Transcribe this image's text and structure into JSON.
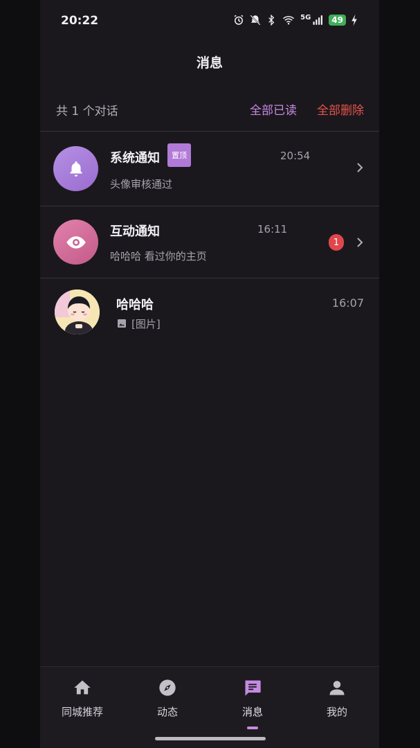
{
  "status_bar": {
    "time": "20:22",
    "network": "5G",
    "battery": "49",
    "icons": [
      "alarm-icon",
      "mute-icon",
      "bluetooth-icon",
      "wifi-icon",
      "signal-icon",
      "charging-icon"
    ]
  },
  "header": {
    "title": "消息"
  },
  "summary": {
    "count_text": "共 1 个对话",
    "mark_all_read": "全部已读",
    "delete_all": "全部删除"
  },
  "conversations": [
    {
      "name": "系统通知",
      "badge": "置顶",
      "time": "20:54",
      "preview": "头像审核通过",
      "icon": "bell-icon"
    },
    {
      "name": "互动通知",
      "time": "16:11",
      "preview": "哈哈哈 看过你的主页",
      "unread": "1",
      "icon": "eye-icon"
    },
    {
      "name": "哈哈哈",
      "time": "16:07",
      "preview": "[图片]",
      "icon": "image-icon"
    }
  ],
  "bottom_nav": {
    "items": [
      {
        "label": "同城推荐",
        "icon": "home-icon"
      },
      {
        "label": "动态",
        "icon": "compass-icon"
      },
      {
        "label": "消息",
        "icon": "message-icon",
        "active": true
      },
      {
        "label": "我的",
        "icon": "person-icon"
      }
    ]
  },
  "colors": {
    "accent": "#c58ae3",
    "danger": "#e5534b",
    "background": "#1b181d"
  }
}
